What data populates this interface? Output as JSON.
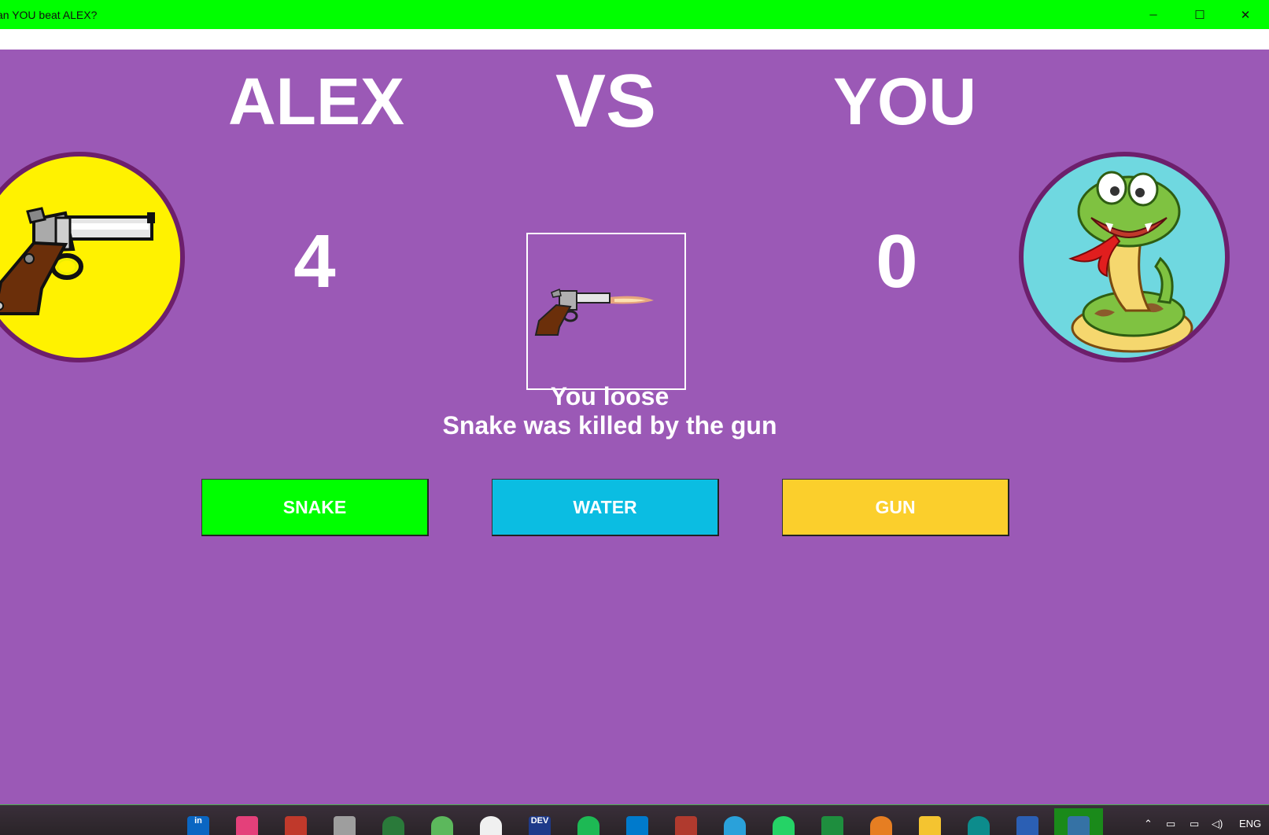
{
  "window": {
    "title": "an YOU beat ALEX?",
    "minimize_symbol": "─",
    "maximize_symbol": "☐",
    "close_symbol": "✕"
  },
  "header": {
    "left_name": "ALEX",
    "vs": "VS",
    "right_name": "YOU"
  },
  "scores": {
    "alex": "4",
    "you": "0"
  },
  "result": {
    "line1": "You loose",
    "line2": "Snake was killed by the gun"
  },
  "buttons": {
    "snake": "SNAKE",
    "water": "WATER",
    "gun": "GUN"
  },
  "taskbar": {
    "dev_label": "DEV",
    "language": "ENG"
  },
  "colors": {
    "background": "#9b59b6",
    "titlebar": "#00ff00",
    "snake_button": "#00ff00",
    "water_button": "#0bbde2",
    "gun_button": "#fbcf2c",
    "alex_avatar": "#fff200",
    "you_avatar": "#6fd8e0"
  },
  "icons": {
    "alex_choice": "revolver-icon",
    "you_choice": "snake-icon",
    "center_result": "firing-revolver-icon"
  }
}
